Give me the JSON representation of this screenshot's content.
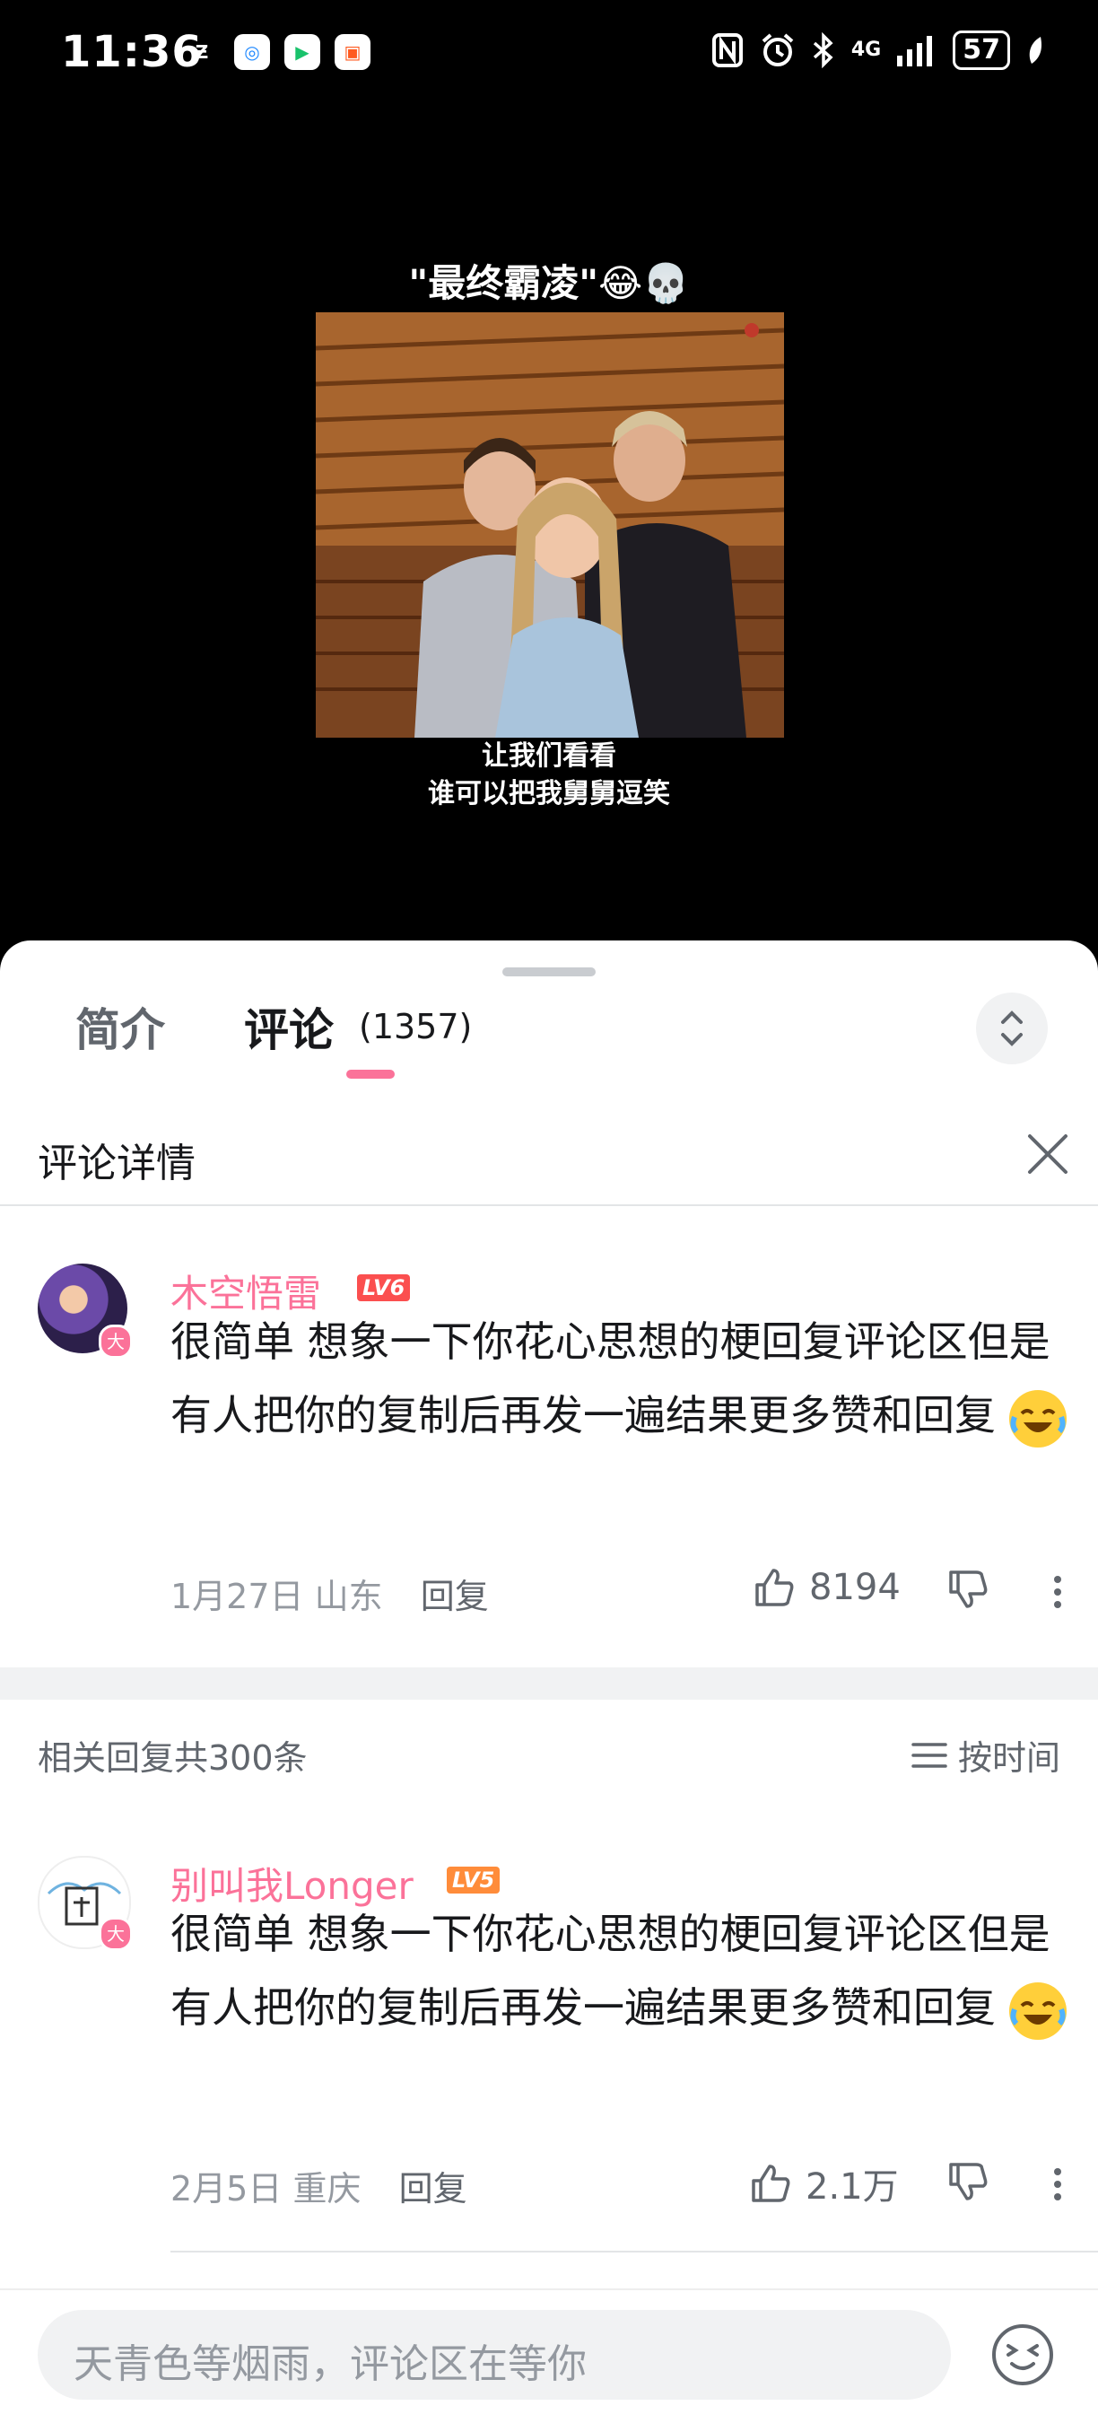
{
  "status_bar": {
    "time": "11:36",
    "battery": "57",
    "network": "4G"
  },
  "video": {
    "title": "\"最终霸凌\"😂💀",
    "subtitle_line1": "让我们看看",
    "subtitle_line2": "谁可以把我舅舅逗笑"
  },
  "tabs": {
    "intro": "简介",
    "comments": "评论",
    "comments_count": "(1357)"
  },
  "detail": {
    "title": "评论详情"
  },
  "main_comment": {
    "username": "木空悟雷",
    "level": "LV6",
    "badge": "大",
    "text": "很简单 想象一下你花心思想的梗回复评论区但是有人把你的复制后再发一遍结果更多赞和回复",
    "date": "1月27日",
    "location": "山东",
    "reply_label": "回复",
    "likes": "8194"
  },
  "replies_header": {
    "count_text": "相关回复共300条",
    "sort_label": "按时间"
  },
  "reply_comment": {
    "username": "别叫我Longer",
    "level": "LV5",
    "badge": "大",
    "text": "很简单 想象一下你花心思想的梗回复评论区但是有人把你的复制后再发一遍结果更多赞和回复",
    "date": "2月5日",
    "location": "重庆",
    "reply_label": "回复",
    "likes": "2.1万"
  },
  "input": {
    "placeholder": "天青色等烟雨，评论区在等你"
  },
  "colors": {
    "accent": "#fb7299",
    "level6": "#fb4f4f",
    "level5": "#ff8c3a"
  }
}
